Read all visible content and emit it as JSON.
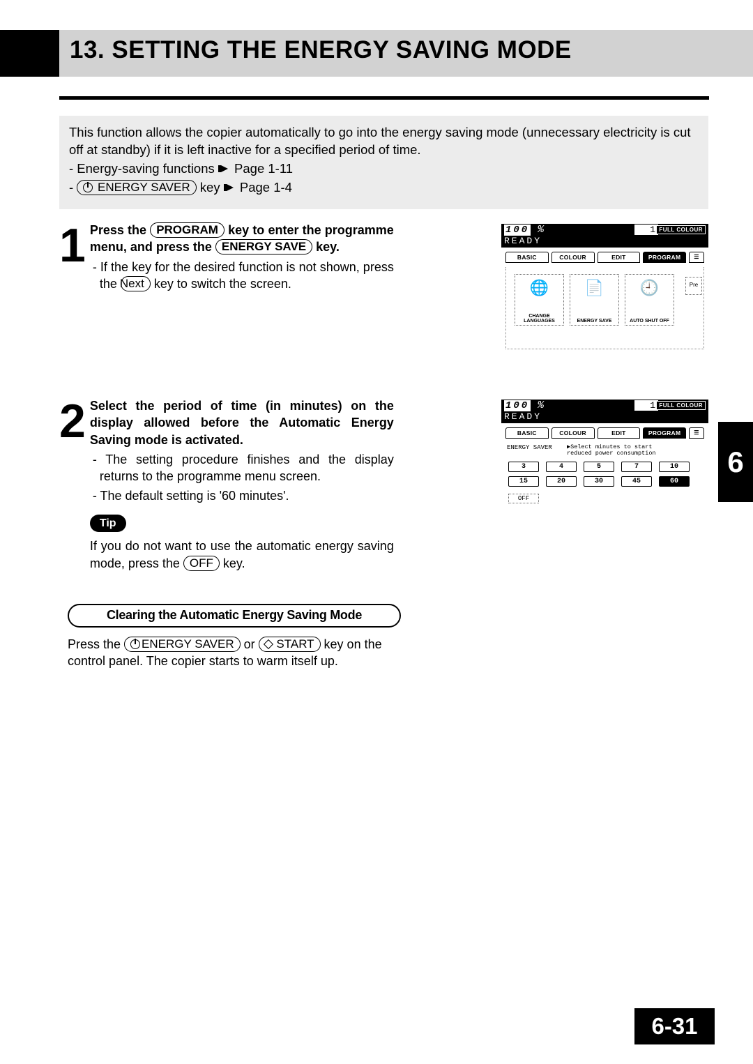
{
  "header": {
    "section_number": "13.",
    "title": "SETTING THE ENERGY SAVING MODE"
  },
  "intro": {
    "text": "This function allows the copier automatically to go into the energy saving mode (unnecessary electricity is cut off at standby) if it is left inactive for a specified period of time.",
    "ref1_label": "- Energy-saving functions",
    "ref1_page": "Page 1-11",
    "ref2_prefix": "-",
    "ref2_key": "ENERGY SAVER",
    "ref2_suffix": "key",
    "ref2_page": "Page 1-4"
  },
  "step1": {
    "num": "1",
    "bold_pre": "Press the ",
    "key1": "PROGRAM",
    "bold_mid": " key to enter the programme menu, and press the ",
    "key2": "ENERGY SAVE",
    "bold_post": " key.",
    "sub1_pre": "- If the key for the desired function is not shown, press the ",
    "sub1_key": "Next",
    "sub1_post": " key to switch the screen."
  },
  "step2": {
    "num": "2",
    "bold": "Select the period of time (in minutes) on the display allowed before the Automatic Energy Saving mode is activated.",
    "sub1": "- The setting procedure finishes and the display returns to the programme menu screen.",
    "sub2": "- The default setting is '60 minutes'.",
    "tip_label": "Tip",
    "tip_text_pre": "If you do not want to use the automatic energy saving mode, press the ",
    "tip_key": "OFF",
    "tip_text_post": " key."
  },
  "clearing": {
    "heading": "Clearing the Automatic Energy Saving Mode",
    "text_pre": "Press the ",
    "key1": "ENERGY SAVER",
    "text_mid": " or ",
    "key2": "START",
    "text_post": " key on the control panel. The copier starts to warm itself up."
  },
  "lcd_common": {
    "zoom": "100",
    "pct": "%",
    "copies": "1",
    "full_colour": "FULL COLOUR",
    "ready": "READY",
    "tabs": [
      "BASIC",
      "COLOUR",
      "EDIT",
      "PROGRAM"
    ]
  },
  "lcd1": {
    "btns": [
      {
        "label": "CHANGE\nLANGUAGES",
        "icon": "🌐"
      },
      {
        "label": "ENERGY SAVE",
        "icon": "⚡"
      },
      {
        "label": "AUTO SHUT OFF",
        "icon": "🕘"
      }
    ],
    "pre": "Pre"
  },
  "lcd2": {
    "label_left": "ENERGY SAVER",
    "label_right": "▶Select minutes to start\n reduced power consumption",
    "minutes_row1": [
      "3",
      "4",
      "5",
      "7",
      "10"
    ],
    "minutes_row2": [
      "15",
      "20",
      "30",
      "45",
      "60"
    ],
    "selected": "60",
    "off": "OFF"
  },
  "side_tab": "6",
  "page_number": "6-31"
}
